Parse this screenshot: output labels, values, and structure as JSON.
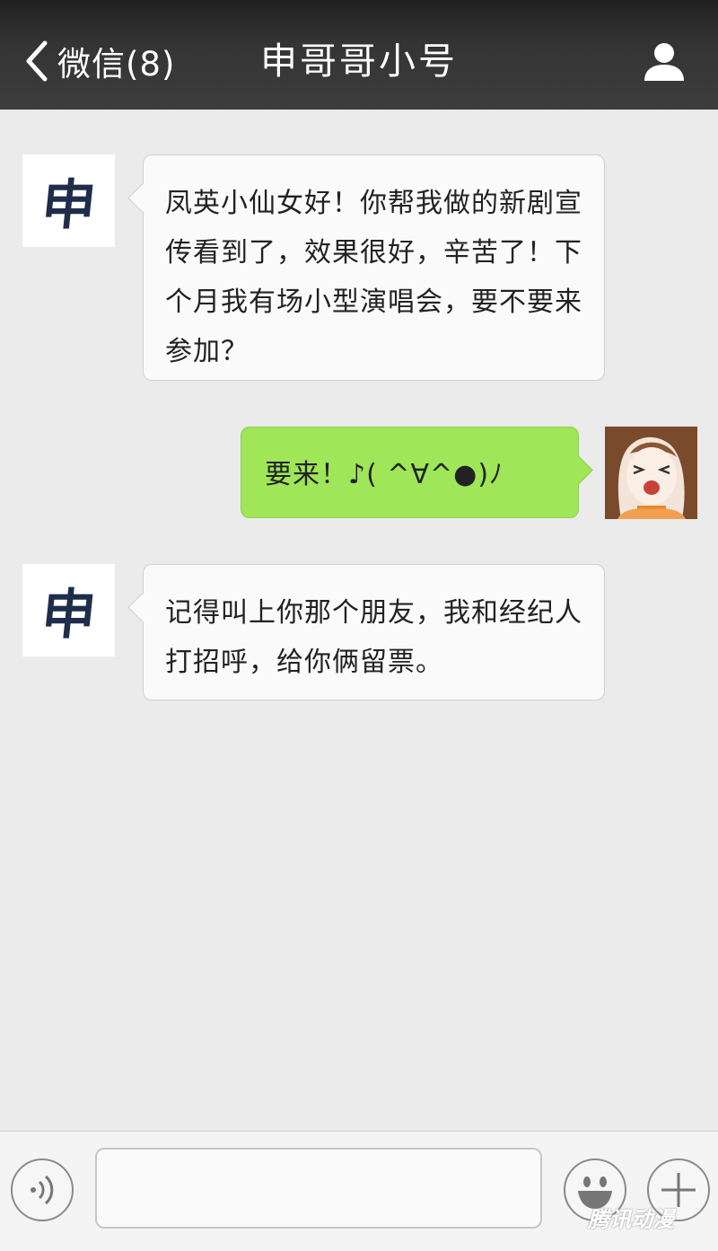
{
  "header": {
    "back_label": "微信(8)",
    "title": "申哥哥小号"
  },
  "messages": [
    {
      "sender": "other",
      "avatar_char": "申",
      "text": "凤英小仙女好！你帮我做的新剧宣传看到了，效果很好，辛苦了！下个月我有场小型演唱会，要不要来参加？"
    },
    {
      "sender": "me",
      "text": "要来！♪( ^∀^●)ﾉ"
    },
    {
      "sender": "other",
      "avatar_char": "申",
      "text": "记得叫上你那个朋友，我和经纪人打招呼，给你俩留票。"
    }
  ],
  "input": {
    "value": "",
    "placeholder": ""
  },
  "watermark": "腾讯动漫",
  "colors": {
    "header": "#343434",
    "background": "#ebebeb",
    "outgoing_bubble": "#9fe658",
    "incoming_bubble": "#fafafa"
  },
  "icons": [
    "back-chevron-icon",
    "user-profile-icon",
    "voice-icon",
    "emoji-icon",
    "plus-icon"
  ]
}
